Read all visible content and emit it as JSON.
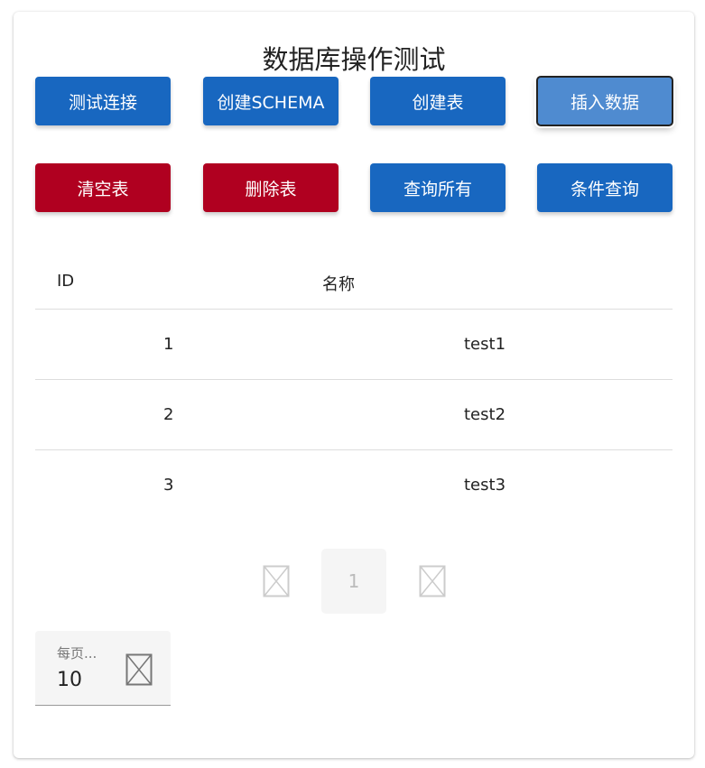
{
  "title": "数据库操作测试",
  "buttons": [
    {
      "label": "测试连接",
      "color": "#1867c0"
    },
    {
      "label": "创建SCHEMA",
      "color": "#1867c0"
    },
    {
      "label": "创建表",
      "color": "#1867c0"
    },
    {
      "label": "插入数据",
      "color": "#4f8bd0"
    },
    {
      "label": "清空表",
      "color": "#b00020"
    },
    {
      "label": "删除表",
      "color": "#b00020"
    },
    {
      "label": "查询所有",
      "color": "#1867c0"
    },
    {
      "label": "条件查询",
      "color": "#1867c0"
    }
  ],
  "table": {
    "headers": [
      "ID",
      "名称"
    ],
    "rows": [
      [
        "1",
        "test1"
      ],
      [
        "2",
        "test2"
      ],
      [
        "3",
        "test3"
      ]
    ]
  },
  "pagination": {
    "current_page": "1",
    "prev_icon": "chevron-left-icon (missing glyph)",
    "next_icon": "chevron-right-icon (missing glyph)"
  },
  "per_page": {
    "label": "每页...",
    "value": "10"
  }
}
